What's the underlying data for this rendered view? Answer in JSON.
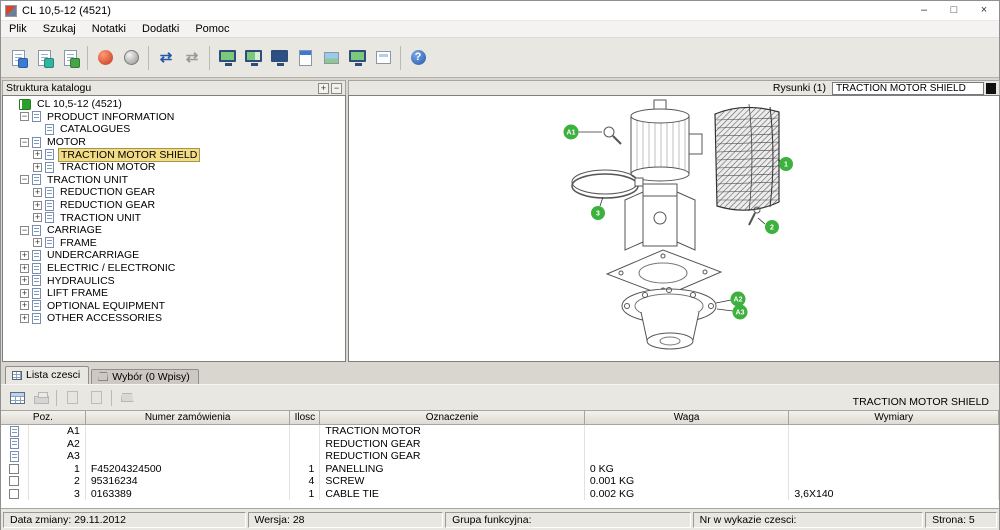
{
  "window": {
    "title": "CL 10,5-12 (4521)",
    "controls": [
      {
        "name": "minimize-button",
        "glyph": "–"
      },
      {
        "name": "maximize-button",
        "glyph": "□"
      },
      {
        "name": "close-button",
        "glyph": "×"
      }
    ]
  },
  "menu": [
    "Plik",
    "Szukaj",
    "Notatki",
    "Dodatki",
    "Pomoc"
  ],
  "toolbar": {
    "buttons": [
      {
        "name": "print-icon",
        "kind": "page",
        "badge": "#3a7bd5"
      },
      {
        "name": "export-icon",
        "kind": "page",
        "badge": "#2fb5a0"
      },
      {
        "name": "add-page-icon",
        "kind": "page",
        "badge": "#46a546"
      },
      {
        "kind": "sep"
      },
      {
        "name": "back-icon",
        "kind": "ball",
        "variant": "red"
      },
      {
        "name": "sphere-icon",
        "kind": "ball",
        "variant": "gray"
      },
      {
        "kind": "sep"
      },
      {
        "name": "transfer-icon",
        "kind": "arrows",
        "variant": "blue",
        "glyph": "⇄"
      },
      {
        "name": "transfer-gray-icon",
        "kind": "arrows",
        "variant": "gray",
        "glyph": "⇄"
      },
      {
        "kind": "sep"
      },
      {
        "name": "view-catalog-icon",
        "kind": "mon",
        "variant": "green"
      },
      {
        "name": "view-parts-list-icon",
        "kind": "mon",
        "variant": "green2"
      },
      {
        "name": "view-drawing-icon",
        "kind": "mon",
        "variant": "blue"
      },
      {
        "name": "view-document-icon",
        "kind": "pageb"
      },
      {
        "name": "view-image-icon",
        "kind": "pageimg"
      },
      {
        "name": "view-screen-icon",
        "kind": "mon",
        "variant": "green"
      },
      {
        "name": "view-window-icon",
        "kind": "pageframe"
      },
      {
        "kind": "sep"
      },
      {
        "name": "help-icon",
        "kind": "help"
      }
    ]
  },
  "catalog_panel": {
    "title": "Struktura katalogu",
    "expand_all": "+",
    "collapse_all": "−",
    "tree": [
      {
        "label": "CL 10,5-12 (4521)",
        "level": 0,
        "icon": "book",
        "expander": "none"
      },
      {
        "label": "PRODUCT INFORMATION",
        "level": 1,
        "icon": "doc",
        "expander": "minus"
      },
      {
        "label": "CATALOGUES",
        "level": 2,
        "icon": "doc",
        "expander": "none"
      },
      {
        "label": "MOTOR",
        "level": 1,
        "icon": "doc",
        "expander": "minus"
      },
      {
        "label": "TRACTION MOTOR SHIELD",
        "level": 2,
        "icon": "doc",
        "expander": "plus",
        "selected": true
      },
      {
        "label": "TRACTION MOTOR",
        "level": 2,
        "icon": "doc",
        "expander": "plus"
      },
      {
        "label": "TRACTION UNIT",
        "level": 1,
        "icon": "doc",
        "expander": "minus"
      },
      {
        "label": "REDUCTION GEAR",
        "level": 2,
        "icon": "doc",
        "expander": "plus"
      },
      {
        "label": "REDUCTION GEAR",
        "level": 2,
        "icon": "doc",
        "expander": "plus"
      },
      {
        "label": "TRACTION UNIT",
        "level": 2,
        "icon": "doc",
        "expander": "plus"
      },
      {
        "label": "CARRIAGE",
        "level": 1,
        "icon": "doc",
        "expander": "minus"
      },
      {
        "label": "FRAME",
        "level": 2,
        "icon": "doc",
        "expander": "plus"
      },
      {
        "label": "UNDERCARRIAGE",
        "level": 1,
        "icon": "doc",
        "expander": "plus"
      },
      {
        "label": "ELECTRIC / ELECTRONIC",
        "level": 1,
        "icon": "doc",
        "expander": "plus"
      },
      {
        "label": "HYDRAULICS",
        "level": 1,
        "icon": "doc",
        "expander": "plus"
      },
      {
        "label": "LIFT FRAME",
        "level": 1,
        "icon": "doc",
        "expander": "plus"
      },
      {
        "label": "OPTIONAL EQUIPMENT",
        "level": 1,
        "icon": "doc",
        "expander": "plus"
      },
      {
        "label": "OTHER ACCESSORIES",
        "level": 1,
        "icon": "doc",
        "expander": "plus"
      }
    ]
  },
  "drawing_panel": {
    "label": "Rysunki (1)",
    "selected_drawing": "TRACTION MOTOR SHIELD",
    "markers": [
      "A1",
      "1",
      "2",
      "3",
      "A2",
      "A3"
    ]
  },
  "parts_panel": {
    "tabs": [
      {
        "label": "Lista czesci",
        "icon": "grid",
        "active": true
      },
      {
        "label": "Wybór (0 Wpisy)",
        "icon": "basket",
        "active": false
      }
    ],
    "toolbar": [
      {
        "name": "parts-table-icon",
        "kind": "grid",
        "disabled": false
      },
      {
        "name": "print-list-icon",
        "kind": "printer",
        "disabled": true
      },
      {
        "kind": "sep"
      },
      {
        "name": "export-list-icon",
        "kind": "page",
        "disabled": true
      },
      {
        "name": "copy-list-icon",
        "kind": "page",
        "disabled": true
      },
      {
        "kind": "sep"
      },
      {
        "name": "basket-icon",
        "kind": "basket",
        "disabled": true
      }
    ],
    "table_title": "TRACTION MOTOR SHIELD",
    "columns": [
      "Poz.",
      "Numer zamówienia",
      "Ilosc",
      "Oznaczenie",
      "Waga",
      "Wymiary"
    ],
    "rows": [
      {
        "icon": "doc",
        "cells": [
          "A1",
          "",
          "",
          "TRACTION MOTOR",
          "",
          ""
        ]
      },
      {
        "icon": "doc",
        "cells": [
          "A2",
          "",
          "",
          "REDUCTION GEAR",
          "",
          ""
        ]
      },
      {
        "icon": "doc",
        "cells": [
          "A3",
          "",
          "",
          "REDUCTION GEAR",
          "",
          ""
        ]
      },
      {
        "icon": "check",
        "cells": [
          "1",
          "F45204324500",
          "1",
          "PANELLING",
          "0 KG",
          ""
        ]
      },
      {
        "icon": "check",
        "cells": [
          "2",
          "95316234",
          "4",
          "SCREW",
          "0.001 KG",
          ""
        ]
      },
      {
        "icon": "check",
        "cells": [
          "3",
          "0163389",
          "1",
          "CABLE TIE",
          "0.002 KG",
          "3,6X140"
        ]
      }
    ]
  },
  "status_bar": {
    "fields": [
      "Data zmiany: 29.11.2012",
      "Wersja: 28",
      "Grupa funkcyjna:",
      "Nr w wykazie czesci:",
      "Strona: 5"
    ]
  }
}
